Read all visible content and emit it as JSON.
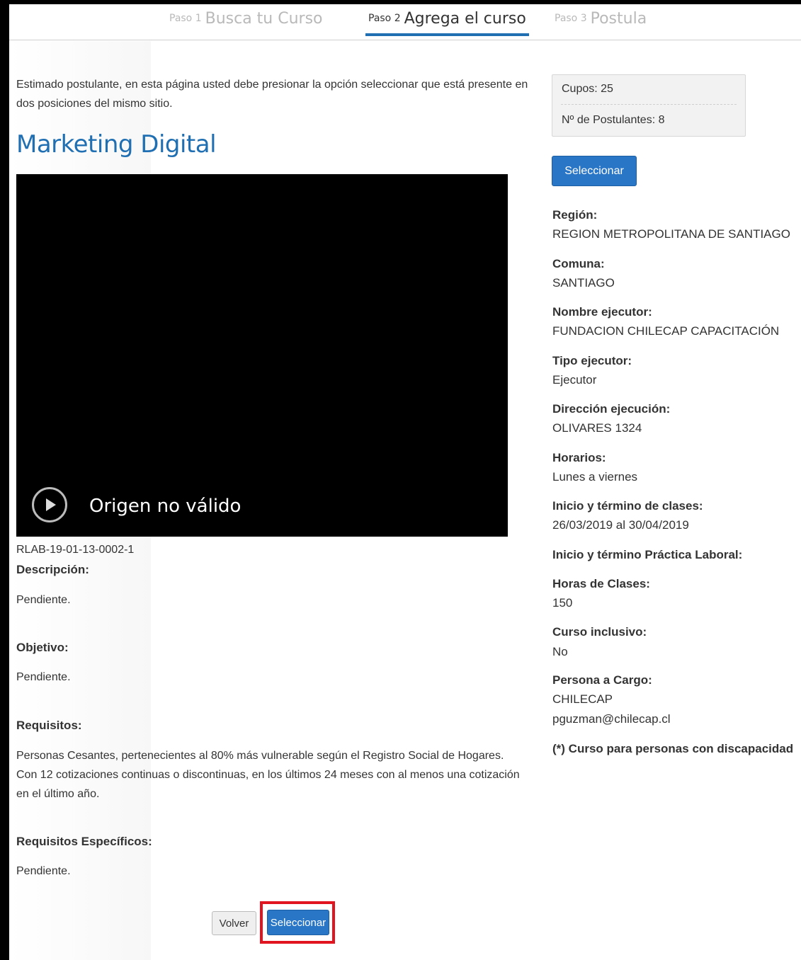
{
  "steps": [
    {
      "num": "Paso 1",
      "label": "Busca tu Curso"
    },
    {
      "num": "Paso 2",
      "label": "Agrega el curso"
    },
    {
      "num": "Paso 3",
      "label": "Postula"
    }
  ],
  "intro": "Estimado postulante, en esta página usted debe presionar la opción seleccionar que está presente en dos posiciones del mismo sitio.",
  "course": {
    "title": "Marketing Digital",
    "video_message": "Origen no válido",
    "code": "RLAB-19-01-13-0002-1"
  },
  "sections": {
    "descripcion": {
      "label": "Descripción:",
      "text": "Pendiente."
    },
    "objetivo": {
      "label": "Objetivo:",
      "text": "Pendiente."
    },
    "requisitos": {
      "label": "Requisitos:",
      "text": "Personas Cesantes, pertenecientes al 80% más vulnerable según el Registro Social de Hogares. Con 12 cotizaciones continuas o discontinuas, en los últimos 24 meses con al menos una cotización en el último año."
    },
    "requisitos_especificos": {
      "label": "Requisitos Específicos:",
      "text": "Pendiente."
    }
  },
  "buttons": {
    "volver": "Volver",
    "seleccionar": "Seleccionar"
  },
  "info_box": {
    "cupos": "Cupos: 25",
    "postulantes": "Nº de Postulantes: 8"
  },
  "details": {
    "region_label": "Región:",
    "region": "REGION METROPOLITANA DE SANTIAGO",
    "comuna_label": "Comuna:",
    "comuna": "SANTIAGO",
    "ejecutor_label": "Nombre ejecutor:",
    "ejecutor": "FUNDACION CHILECAP CAPACITACIÓN",
    "tipo_label": "Tipo ejecutor:",
    "tipo": "Ejecutor",
    "direccion_label": "Dirección ejecución:",
    "direccion": "OLIVARES 1324",
    "horarios_label": "Horarios:",
    "horarios": "Lunes a viernes",
    "inicio_label": "Inicio y término de clases:",
    "inicio": "26/03/2019 al 30/04/2019",
    "practica_label": "Inicio y término Práctica Laboral:",
    "horas_label": "Horas de Clases:",
    "horas": "150",
    "inclusivo_label": "Curso inclusivo:",
    "inclusivo": "No",
    "persona_label": "Persona a Cargo:",
    "persona": "CHILECAP",
    "email": "pguzman@chilecap.cl",
    "nota": "(*) Curso para personas con discapacidad"
  },
  "colors": {
    "accent": "#1f6fb2",
    "button": "#2a76c6",
    "highlight": "#e0151f"
  }
}
